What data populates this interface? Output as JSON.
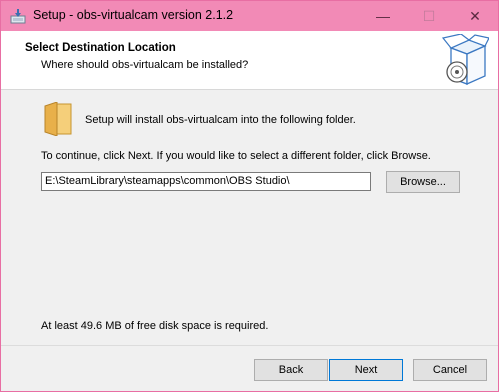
{
  "window": {
    "title": "Setup - obs-virtualcam version 2.1.2",
    "minimize_glyph": "—",
    "maximize_glyph": "☐",
    "close_glyph": "✕"
  },
  "header": {
    "title": "Select Destination Location",
    "subtitle": "Where should obs-virtualcam be installed?"
  },
  "body": {
    "install_text": "Setup will install obs-virtualcam into the following folder.",
    "continue_text": "To continue, click Next. If you would like to select a different folder, click Browse.",
    "path_value": "E:\\SteamLibrary\\steamapps\\common\\OBS Studio\\",
    "browse_label": "Browse...",
    "disk_space_text": "At least 49.6 MB of free disk space is required."
  },
  "footer": {
    "back_label": "Back",
    "next_label": "Next",
    "cancel_label": "Cancel"
  },
  "colors": {
    "titlebar": "#f28ab6",
    "focus_border": "#0078d7"
  },
  "icons": [
    "setup-app-icon",
    "install-box-icon",
    "folder-icon"
  ]
}
